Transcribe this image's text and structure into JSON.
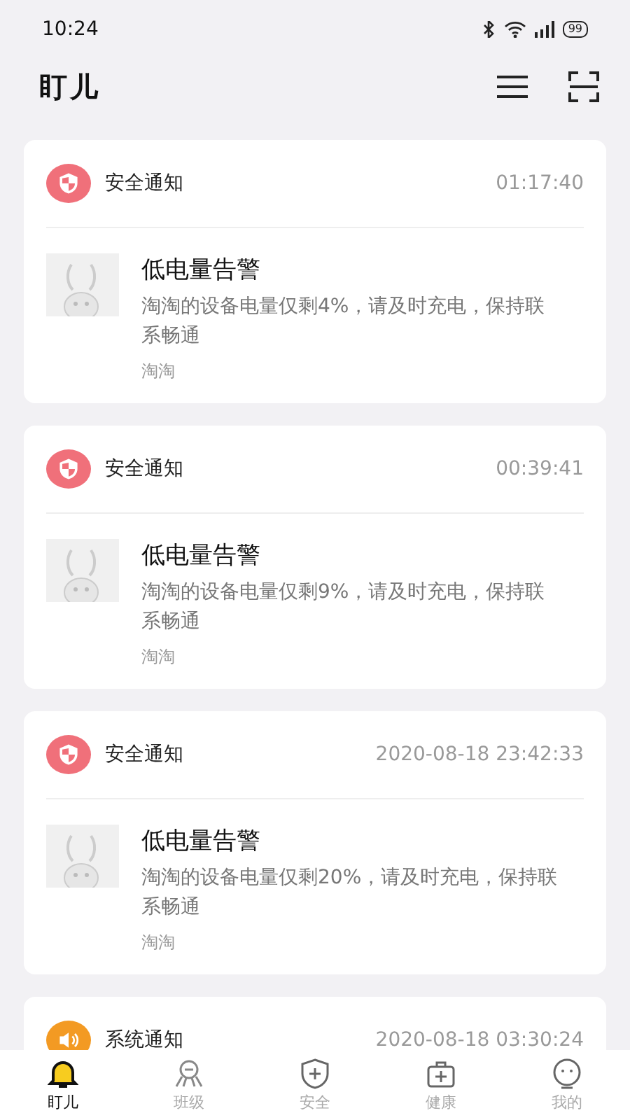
{
  "status_bar": {
    "time": "10:24",
    "battery": "99"
  },
  "header": {
    "title": "盯儿"
  },
  "notifications": [
    {
      "kind": "safety",
      "category": "安全通知",
      "time": "01:17:40",
      "title": "低电量告警",
      "message": "淘淘的设备电量仅剩4%，请及时充电，保持联系畅通",
      "child": "淘淘"
    },
    {
      "kind": "safety",
      "category": "安全通知",
      "time": "00:39:41",
      "title": "低电量告警",
      "message": "淘淘的设备电量仅剩9%，请及时充电，保持联系畅通",
      "child": "淘淘"
    },
    {
      "kind": "safety",
      "category": "安全通知",
      "time": "2020-08-18 23:42:33",
      "title": "低电量告警",
      "message": "淘淘的设备电量仅剩20%，请及时充电，保持联系畅通",
      "child": "淘淘"
    },
    {
      "kind": "system",
      "category": "系统通知",
      "time": "2020-08-18 03:30:24"
    }
  ],
  "tab_bar": [
    {
      "kind": "bell",
      "label": "盯儿",
      "selected": true
    },
    {
      "kind": "group",
      "label": "班级",
      "selected": false
    },
    {
      "kind": "shield",
      "label": "安全",
      "selected": false
    },
    {
      "kind": "kit",
      "label": "健康",
      "selected": false
    },
    {
      "kind": "face",
      "label": "我的",
      "selected": false
    }
  ]
}
